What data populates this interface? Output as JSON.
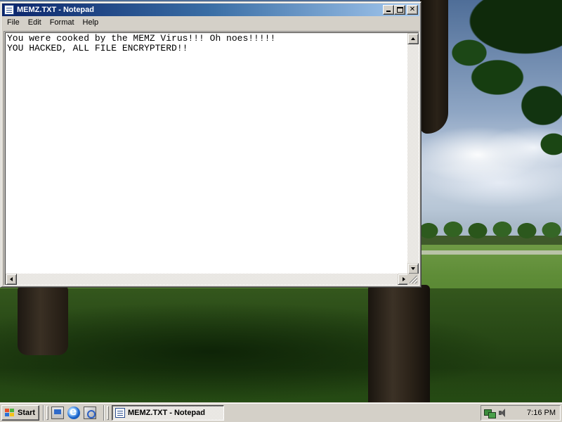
{
  "window": {
    "title": "MEMZ.TXT - Notepad",
    "menu": [
      "File",
      "Edit",
      "Format",
      "Help"
    ]
  },
  "document": {
    "lines": [
      "You were cooked by the MEMZ Virus!!! Oh noes!!!!!",
      "YOU HACKED, ALL FILE ENCRYPTERD!!"
    ]
  },
  "taskbar": {
    "start_label": "Start",
    "task_button_label": "MEMZ.TXT - Notepad",
    "clock": "7:16 PM",
    "quick_launch": [
      "show-desktop-icon",
      "internet-explorer-icon",
      "channels-icon"
    ]
  },
  "colors": {
    "titlebar_start": "#0a246a",
    "titlebar_end": "#a6caf0",
    "chrome": "#d4d0c8"
  }
}
